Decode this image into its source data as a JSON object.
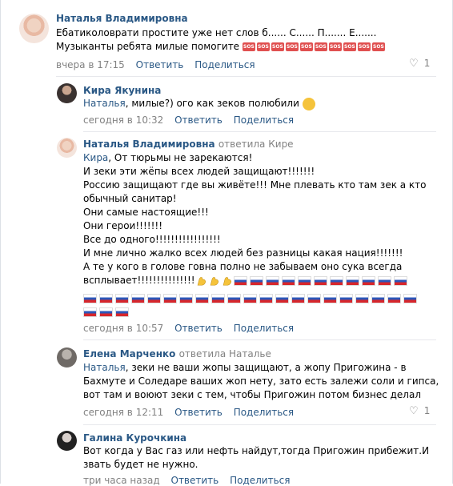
{
  "comments": [
    {
      "author": "Наталья Владимировна",
      "lines": [
        "Ебатиколоврати простите уже нет слов б...... С...... П....... Е.......",
        "Музыканты ребята милые помогите"
      ],
      "sos_badge": "SOS",
      "sos_count": 10,
      "time": "вчера в 17:15",
      "reply": "Ответить",
      "share": "Поделиться",
      "likes": "1"
    },
    {
      "author": "Кира Якунина",
      "addressee": "Наталья",
      "text": ", милые?) ого как зеков полюбили",
      "time": "сегодня в 10:32",
      "reply": "Ответить",
      "share": "Поделиться"
    },
    {
      "author": "Наталья Владимировна",
      "reply_to_prefix": "ответила",
      "reply_to": "Кире",
      "addressee": "Кира",
      "first_line": ", От тюрьмы не зарекаются!",
      "lines": [
        "И зеки эти жёпы всех людей защищают!!!!!!!",
        "Россию защищают где вы живёте!!! Мне плевать кто там зек а кто",
        "обычный санитар!",
        "Они самые настоящие!!!",
        "Они герои!!!!!!!",
        "Все до одного!!!!!!!!!!!!!!!!!",
        "И мне лично жалко всех людей без разницы какая нация!!!!!!!",
        "А те у кого в голове говна полно не забываем оно сука всегда",
        "всплывает!!!!!!!!!!!!!!!"
      ],
      "time": "сегодня в 10:57",
      "reply": "Ответить",
      "share": "Поделиться"
    },
    {
      "author": "Елена Марченко",
      "reply_to_prefix": "ответила",
      "reply_to": "Наталье",
      "addressee": "Наталья",
      "first_line": ", зеки не ваши жопы защищают, а жопу Пригожина - в",
      "lines": [
        "Бахмуте и Соледаре ваших жоп нету, зато есть залежи соли и гипса,",
        "вот там и воюют зеки с тем, чтобы Пригожин потом бизнес делал"
      ],
      "time": "сегодня в 12:11",
      "reply": "Ответить",
      "share": "Поделиться",
      "likes": "1"
    },
    {
      "author": "Галина Курочкина",
      "lines": [
        "Вот когда у Вас газ или нефть найдут,тогда Пригожин прибежит.И",
        "звать будет не нужно."
      ],
      "time": "три часа назад",
      "reply": "Ответить",
      "share": "Поделиться"
    }
  ],
  "colors": {
    "link": "#2a5885",
    "meta": "#828282",
    "separator": "#e7e8ec"
  }
}
